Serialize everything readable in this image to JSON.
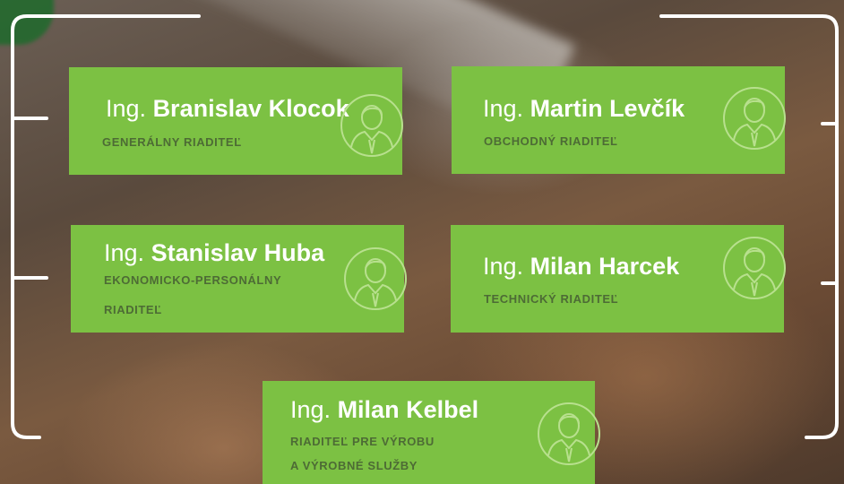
{
  "colors": {
    "card_green": "#7cc143",
    "role_text": "#4d6b35",
    "bracket": "#ffffff"
  },
  "directors": [
    {
      "title": "Ing.",
      "name": "Branislav Klocok",
      "role": "GENERÁLNY RIADITEĽ",
      "icon": "user-avatar-icon"
    },
    {
      "title": "Ing.",
      "name": "Martin Levčík",
      "role": "OBCHODNÝ RIADITEĽ",
      "icon": "user-avatar-icon"
    },
    {
      "title": "Ing.",
      "name": "Stanislav Huba",
      "role_line1": "EKONOMICKO-PERSONÁLNY",
      "role_line2": "RIADITEĽ",
      "icon": "user-avatar-icon"
    },
    {
      "title": "Ing.",
      "name": "Milan Harcek",
      "role": "TECHNICKÝ RIADITEĽ",
      "icon": "user-avatar-icon"
    },
    {
      "title": "Ing.",
      "name": "Milan Kelbel",
      "role_line1": "RIADITEĽ PRE VÝROBU",
      "role_line2": "A VÝROBNÉ SLUŽBY",
      "icon": "user-avatar-icon"
    }
  ]
}
